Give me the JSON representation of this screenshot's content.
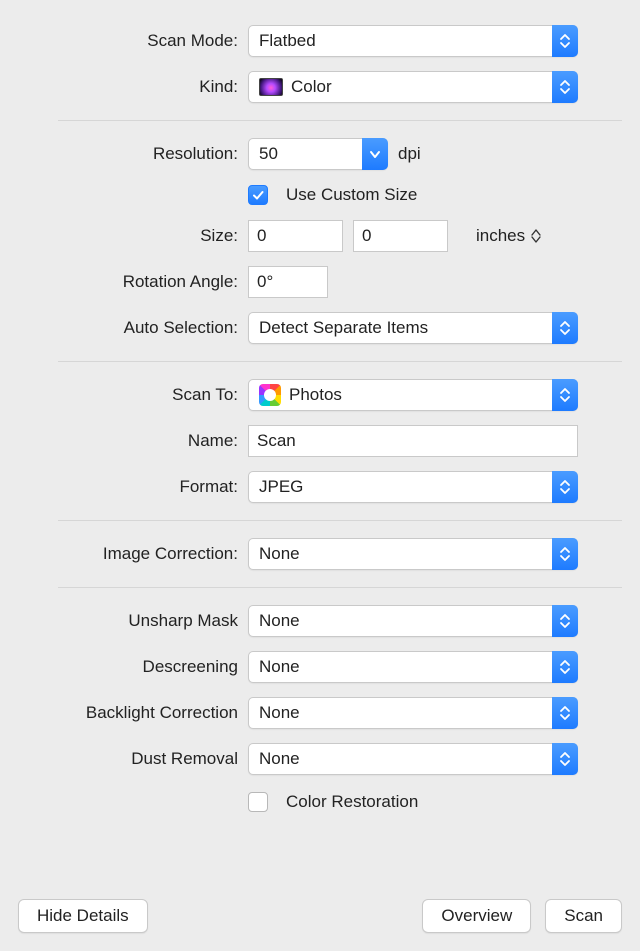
{
  "labels": {
    "scan_mode": "Scan Mode:",
    "kind": "Kind:",
    "resolution": "Resolution:",
    "dpi": "dpi",
    "custom_size": "Use Custom Size",
    "size": "Size:",
    "inches": "inches",
    "rotation": "Rotation Angle:",
    "auto_selection": "Auto Selection:",
    "scan_to": "Scan To:",
    "name": "Name:",
    "format": "Format:",
    "image_correction": "Image Correction:",
    "unsharp_mask": "Unsharp Mask",
    "descreening": "Descreening",
    "backlight": "Backlight Correction",
    "dust": "Dust Removal",
    "color_restoration": "Color Restoration"
  },
  "values": {
    "scan_mode": "Flatbed",
    "kind": "Color",
    "resolution": "50",
    "size_w": "0",
    "size_h": "0",
    "rotation": "0°",
    "auto_selection": "Detect Separate Items",
    "scan_to": "Photos",
    "name": "Scan",
    "format": "JPEG",
    "image_correction": "None",
    "unsharp_mask": "None",
    "descreening": "None",
    "backlight": "None",
    "dust": "None"
  },
  "buttons": {
    "hide_details": "Hide Details",
    "overview": "Overview",
    "scan": "Scan"
  },
  "state": {
    "custom_size_checked": true,
    "color_restoration_checked": false
  }
}
